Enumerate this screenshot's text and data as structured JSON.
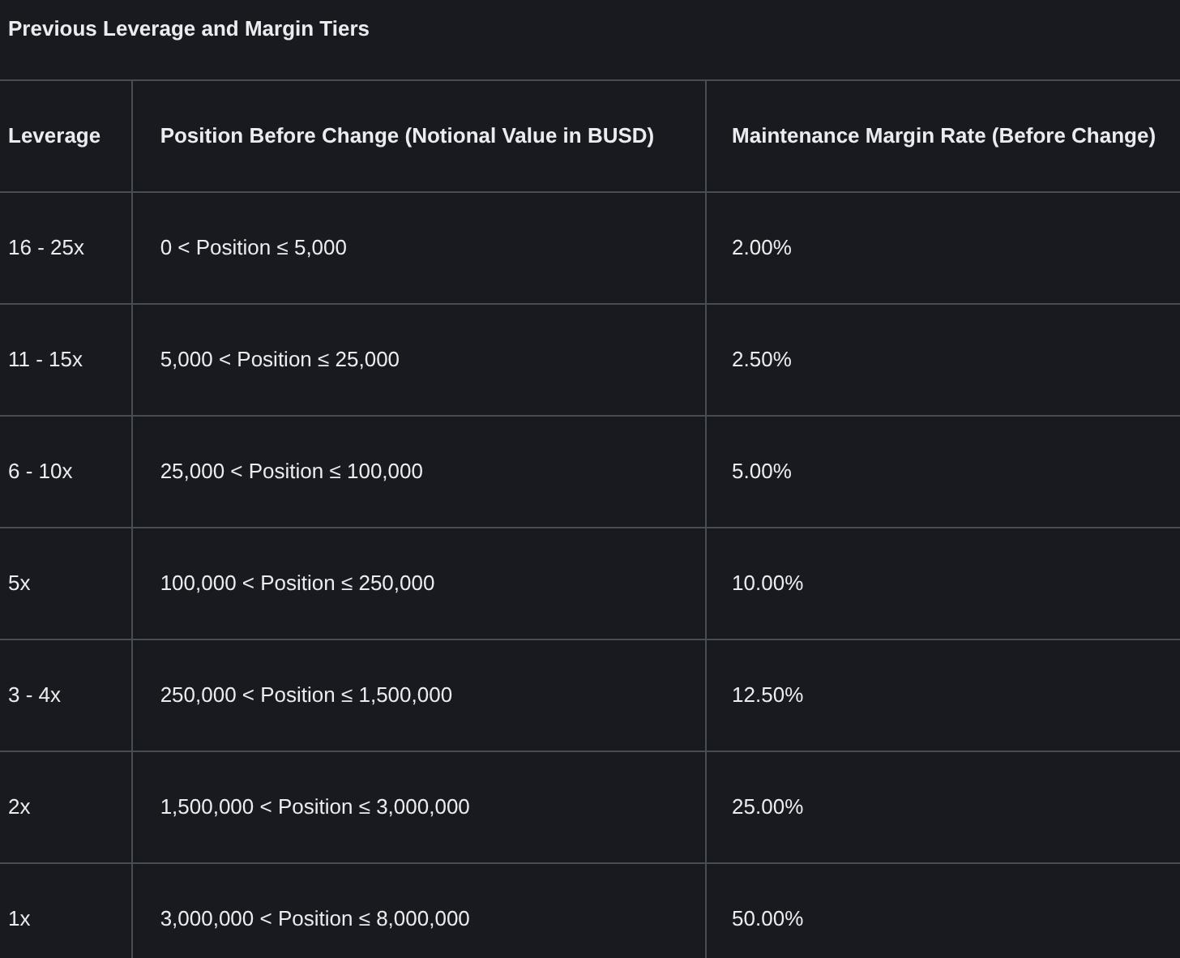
{
  "title": "Previous Leverage and Margin Tiers",
  "table": {
    "columns": [
      "Leverage",
      "Position Before Change (Notional Value in BUSD)",
      "Maintenance Margin Rate (Before Change)"
    ],
    "rows": [
      [
        "16 - 25x",
        "0 < Position ≤ 5,000",
        "2.00%"
      ],
      [
        "11 - 15x",
        "5,000 < Position ≤ 25,000",
        "2.50%"
      ],
      [
        "6 - 10x",
        "25,000 < Position ≤ 100,000",
        "5.00%"
      ],
      [
        "5x",
        "100,000 < Position ≤ 250,000",
        "10.00%"
      ],
      [
        "3 - 4x",
        "250,000 < Position ≤ 1,500,000",
        "12.50%"
      ],
      [
        "2x",
        "1,500,000 < Position ≤ 3,000,000",
        "25.00%"
      ],
      [
        "1x",
        "3,000,000 < Position ≤ 8,000,000",
        "50.00%"
      ]
    ]
  }
}
